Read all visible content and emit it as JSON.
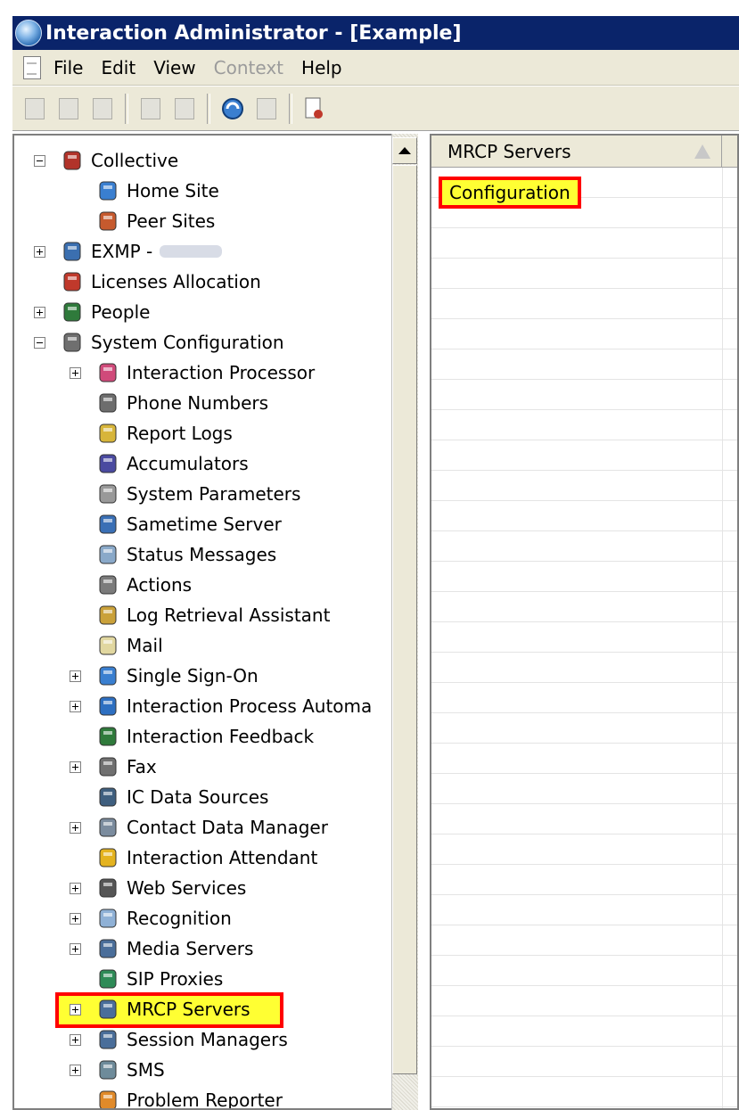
{
  "window": {
    "title": "Interaction Administrator - [Example]"
  },
  "menu": [
    {
      "label": "File",
      "enabled": true
    },
    {
      "label": "Edit",
      "enabled": true
    },
    {
      "label": "View",
      "enabled": true
    },
    {
      "label": "Context",
      "enabled": false
    },
    {
      "label": "Help",
      "enabled": true
    }
  ],
  "toolbar": [
    "new-icon",
    "edit-icon",
    "delete-icon",
    "copy-icon",
    "paste-icon",
    "refresh-icon",
    "filter-icon",
    "license-icon"
  ],
  "tree": {
    "items": [
      {
        "label": "Collective",
        "icon": "collective-icon",
        "expander": "minus"
      },
      {
        "label": "Home Site",
        "icon": "home-site-icon"
      },
      {
        "label": "Peer Sites",
        "icon": "peer-sites-icon"
      },
      {
        "label": "EXMP -",
        "icon": "server-icon",
        "expander": "plus"
      },
      {
        "label": "Licenses Allocation",
        "icon": "license-icon"
      },
      {
        "label": "People",
        "icon": "people-icon",
        "expander": "plus"
      },
      {
        "label": "System Configuration",
        "icon": "system-config-icon",
        "expander": "minus"
      },
      {
        "label": "Interaction Processor",
        "icon": "processor-icon",
        "expander": "plus"
      },
      {
        "label": "Phone Numbers",
        "icon": "phone-icon"
      },
      {
        "label": "Report Logs",
        "icon": "report-logs-icon"
      },
      {
        "label": "Accumulators",
        "icon": "accumulator-icon"
      },
      {
        "label": "System Parameters",
        "icon": "gears-icon"
      },
      {
        "label": "Sametime Server",
        "icon": "sametime-icon"
      },
      {
        "label": "Status Messages",
        "icon": "status-icon"
      },
      {
        "label": "Actions",
        "icon": "actions-icon"
      },
      {
        "label": "Log Retrieval Assistant",
        "icon": "log-retrieval-icon"
      },
      {
        "label": "Mail",
        "icon": "mail-icon"
      },
      {
        "label": "Single Sign-On",
        "icon": "sso-icon",
        "expander": "plus"
      },
      {
        "label": "Interaction Process Automa",
        "icon": "process-icon",
        "expander": "plus"
      },
      {
        "label": "Interaction Feedback",
        "icon": "feedback-icon"
      },
      {
        "label": "Fax",
        "icon": "fax-icon",
        "expander": "plus"
      },
      {
        "label": "IC Data Sources",
        "icon": "data-sources-icon"
      },
      {
        "label": "Contact Data Manager",
        "icon": "contact-data-icon",
        "expander": "plus"
      },
      {
        "label": "Interaction Attendant",
        "icon": "attendant-icon"
      },
      {
        "label": "Web Services",
        "icon": "web-services-icon",
        "expander": "plus"
      },
      {
        "label": "Recognition",
        "icon": "recognition-icon",
        "expander": "plus"
      },
      {
        "label": "Media Servers",
        "icon": "media-server-icon",
        "expander": "plus"
      },
      {
        "label": "SIP Proxies",
        "icon": "sip-proxy-icon"
      },
      {
        "label": "MRCP Servers",
        "icon": "mrcp-server-icon",
        "expander": "plus",
        "highlighted": true
      },
      {
        "label": "Session Managers",
        "icon": "session-manager-icon",
        "expander": "plus"
      },
      {
        "label": "SMS",
        "icon": "sms-icon",
        "expander": "plus"
      },
      {
        "label": "Problem Reporter",
        "icon": "problem-reporter-icon"
      }
    ]
  },
  "list": {
    "column_header": "MRCP Servers",
    "rows": [
      "Configuration"
    ]
  },
  "colors": {
    "titlebar": "#0a246a",
    "highlight_fill": "#ffff33",
    "highlight_border": "#ff0000",
    "chrome": "#ece9d8"
  }
}
